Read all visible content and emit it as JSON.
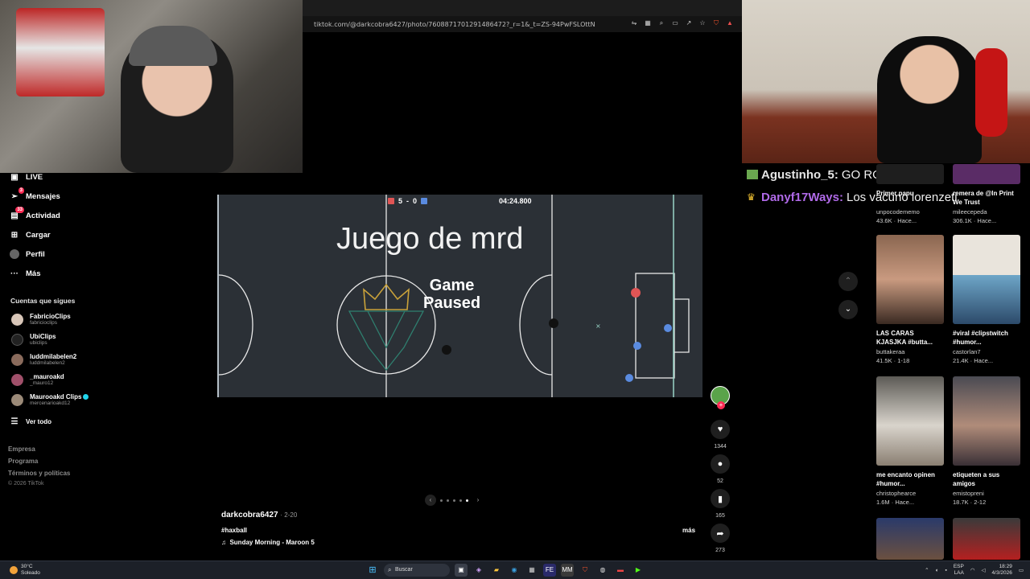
{
  "browser": {
    "url": "tiktok.com/@darkcobra6427/photo/7608871701291486472?_r=1&_t=ZS-94PwFSLOttN"
  },
  "sidebar": {
    "nav": [
      {
        "label": "LIVE",
        "icon": "live-icon",
        "badge": ""
      },
      {
        "label": "Mensajes",
        "icon": "paper-plane-icon",
        "badge": "3"
      },
      {
        "label": "Actividad",
        "icon": "activity-icon",
        "badge": "33"
      },
      {
        "label": "Cargar",
        "icon": "upload-icon",
        "badge": ""
      },
      {
        "label": "Perfil",
        "icon": "profile-icon",
        "badge": ""
      },
      {
        "label": "Más",
        "icon": "more-icon",
        "badge": ""
      }
    ],
    "following_title": "Cuentas que sigues",
    "following": [
      {
        "name": "FabricioClips",
        "handle": "fabricioclips"
      },
      {
        "name": "UbiClips",
        "handle": "ubiclips"
      },
      {
        "name": "luddmilabelen2",
        "handle": "luddmilabelen2"
      },
      {
        "name": "_mauroakd",
        "handle": "_mauro12"
      },
      {
        "name": "Maurooakd Clips",
        "handle": "mercenarioakd12"
      }
    ],
    "see_all": "Ver todo",
    "footer": [
      "Empresa",
      "Programa",
      "Términos y políticas"
    ],
    "copyright": "© 2026 TikTok"
  },
  "game": {
    "score_red": "5",
    "score_sep": "-",
    "score_blue": "0",
    "timer": "04:24.800",
    "overlay_text": "Juego de mrd",
    "paused_line1": "Game",
    "paused_line2": "Paused",
    "colors": {
      "red": "#e05555",
      "blue": "#5a8be0",
      "field": "#2b3036"
    }
  },
  "post": {
    "author": "darkcobra6427",
    "date": "2-20",
    "hashtag": "#haxball",
    "music": "Sunday Morning - Maroon 5",
    "more": "más",
    "likes": "1344",
    "comments": "52",
    "saves": "165",
    "shares": "273"
  },
  "chat": [
    {
      "user": "Agustinho_5:",
      "message": "GO ROVLOX",
      "badge": "minecraft-block-icon"
    },
    {
      "user": "Danyf17Ways:",
      "message": "Los vacuno lorenzeti",
      "badge": "crown-icon"
    }
  ],
  "recommended": [
    {
      "title": "Primer papu",
      "creator": "unpocodememo",
      "stats": "43.6K · Hace..."
    },
    {
      "title": "remera de @In Print We Trust",
      "creator": "mileecepeda",
      "stats": "306.1K · Hace..."
    },
    {
      "title": "LAS CARAS KJASJKA #butta...",
      "creator": "buttakeraa",
      "stats": "41.5K · 1-18"
    },
    {
      "title": "#viral #clipstwitch #humor...",
      "creator": "castorlan7",
      "stats": "21.4K · Hace..."
    },
    {
      "title": "me encanto opinen #humor...",
      "creator": "christophearce",
      "stats": "1.6M · Hace..."
    },
    {
      "title": "etiqueten a sus amigos",
      "creator": "emistopreni",
      "stats": "18.7K · 2-12"
    }
  ],
  "taskbar": {
    "temp": "30°C",
    "weather": "Soleado",
    "search": "Buscar",
    "lang": "ESP",
    "layout": "LAA",
    "time": "18:29",
    "date": "4/3/2026"
  }
}
